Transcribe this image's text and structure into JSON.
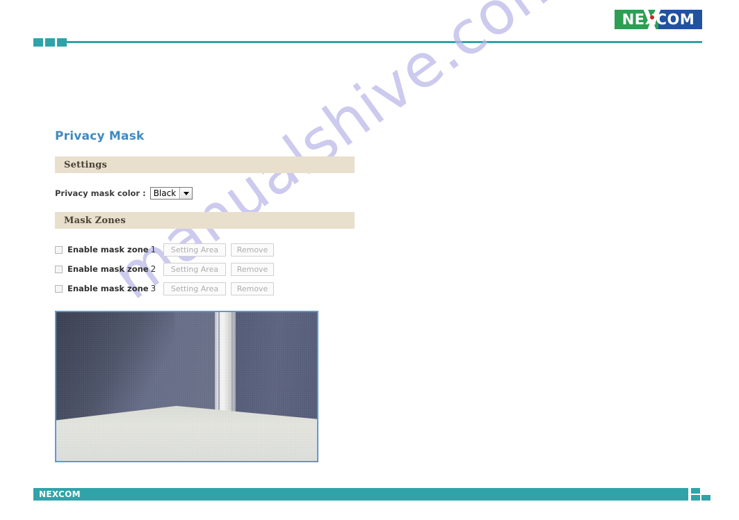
{
  "header": {
    "logo_text": "NEXCOM",
    "logo_green": "#2e9e54",
    "logo_blue": "#2152a0",
    "logo_dot_color": "#d81f26",
    "rule_color": "#2fa3a8"
  },
  "watermark": {
    "text": "manualshive.com",
    "color": "#b9b7e8"
  },
  "page": {
    "title": "Privacy Mask",
    "title_color": "#3f8ac0"
  },
  "settings": {
    "section_label": "Settings",
    "section_bg": "#e8dfcc",
    "color_label": "Privacy mask color :",
    "color_value": "Black",
    "color_options": [
      "Black"
    ],
    "dropdown_icon": "chevron-down-icon"
  },
  "mask_zones": {
    "section_label": "Mask Zones",
    "rows": [
      {
        "checked": false,
        "label": "Enable mask zone",
        "number": "1",
        "setting_button": "Setting Area",
        "remove_button": "Remove"
      },
      {
        "checked": false,
        "label": "Enable mask zone",
        "number": "2",
        "setting_button": "Setting Area",
        "remove_button": "Remove"
      },
      {
        "checked": false,
        "label": "Enable mask zone",
        "number": "3",
        "setting_button": "Setting Area",
        "remove_button": "Remove"
      }
    ]
  },
  "preview": {
    "border_color": "#5b9ad5"
  },
  "footer": {
    "logo_text": "NEXCOM",
    "bar_color": "#2fa3a8"
  }
}
